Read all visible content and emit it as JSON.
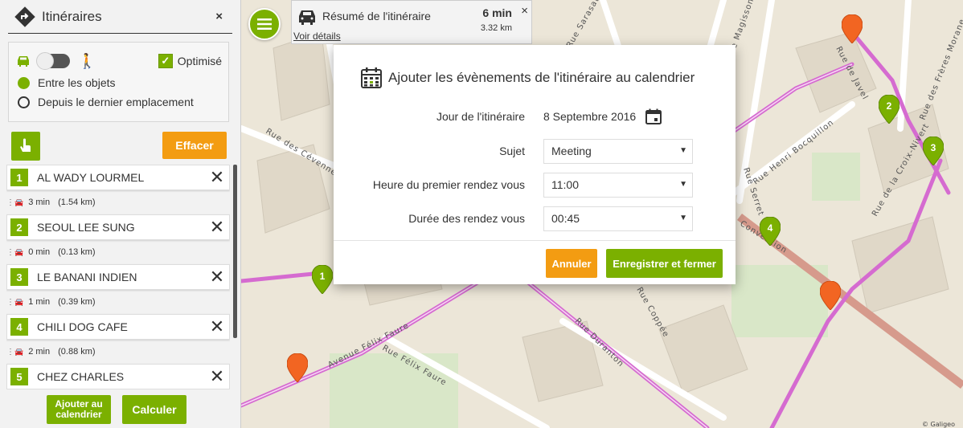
{
  "sidebar": {
    "title": "Itinéraires",
    "close": "×",
    "optimise_label": "Optimisé",
    "optimise_checked": true,
    "radio_options": [
      "Entre les objets",
      "Depuis le dernier emplacement"
    ],
    "radio_selected": 0,
    "effacer_label": "Effacer",
    "stops": [
      {
        "num": "1",
        "name": "AL WADY LOURMEL"
      },
      {
        "num": "2",
        "name": "SEOUL LEE SUNG"
      },
      {
        "num": "3",
        "name": "LE BANANI INDIEN"
      },
      {
        "num": "4",
        "name": "CHILI DOG CAFE"
      },
      {
        "num": "5",
        "name": "CHEZ CHARLES"
      }
    ],
    "legs": [
      {
        "time": "3 min",
        "dist": "(1.54 km)"
      },
      {
        "time": "0 min",
        "dist": "(0.13 km)"
      },
      {
        "time": "1 min",
        "dist": "(0.39 km)"
      },
      {
        "time": "2 min",
        "dist": "(0.88 km)"
      }
    ],
    "add_calendar_label": "Ajouter au calendrier",
    "calculer_label": "Calculer"
  },
  "summary": {
    "title": "Résumé de l'itinéraire",
    "time": "6 min",
    "distance": "3.32 km",
    "link": "Voir détails",
    "close": "×"
  },
  "modal": {
    "title": "Ajouter les évènements de l'itinéraire au calendrier",
    "fields": [
      {
        "label": "Jour de l'itinéraire",
        "value": "8 Septembre 2016"
      },
      {
        "label": "Sujet",
        "value": "Meeting"
      },
      {
        "label": "Heure du premier rendez vous",
        "value": "11:00"
      },
      {
        "label": "Durée des rendez vous",
        "value": "00:45"
      }
    ],
    "cancel_label": "Annuler",
    "save_label": "Enregistrer et fermer"
  },
  "map": {
    "streets": [
      "Rue des Cévennes",
      "Avenue Félix Faure",
      "Rue Félix Faure",
      "Rue Duranton",
      "Rue Henri Bocquillon",
      "Rue de Javel",
      "Rue de la Croix-Nivert",
      "Convention",
      "Rue des Frères Morane",
      "Rue Sarasate",
      "Rue Serret",
      "Rue Coppée",
      "Rue Magisson"
    ],
    "markers": [
      "1",
      "2",
      "3",
      "4"
    ],
    "credit": "© Galigeo"
  },
  "colors": {
    "accent": "#7bb000",
    "warning": "#f39c12",
    "route": "#d56bd0"
  }
}
